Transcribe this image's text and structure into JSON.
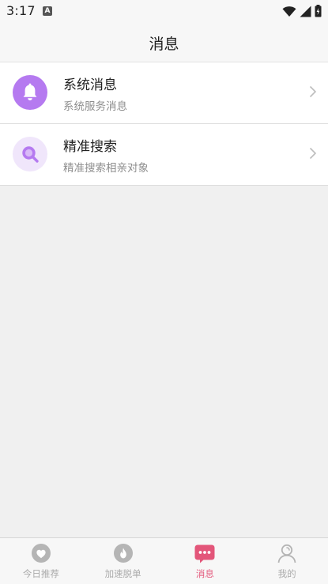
{
  "status_bar": {
    "time": "3:17",
    "notification_icon_letter": "A"
  },
  "header": {
    "title": "消息"
  },
  "list": [
    {
      "title": "系统消息",
      "subtitle": "系统服务消息",
      "icon": "bell-icon",
      "icon_bg": "#b57af0"
    },
    {
      "title": "精准搜索",
      "subtitle": "精准搜索相亲对象",
      "icon": "search-icon",
      "icon_bg": "#f0e6fb"
    }
  ],
  "tabbar": {
    "tabs": [
      {
        "label": "今日推荐",
        "icon": "heart-icon",
        "active": false
      },
      {
        "label": "加速脱单",
        "icon": "flame-icon",
        "active": false
      },
      {
        "label": "消息",
        "icon": "message-icon",
        "active": true
      },
      {
        "label": "我的",
        "icon": "profile-icon",
        "active": false
      }
    ],
    "active_color": "#e3567a",
    "inactive_color": "#b5b5b5"
  }
}
